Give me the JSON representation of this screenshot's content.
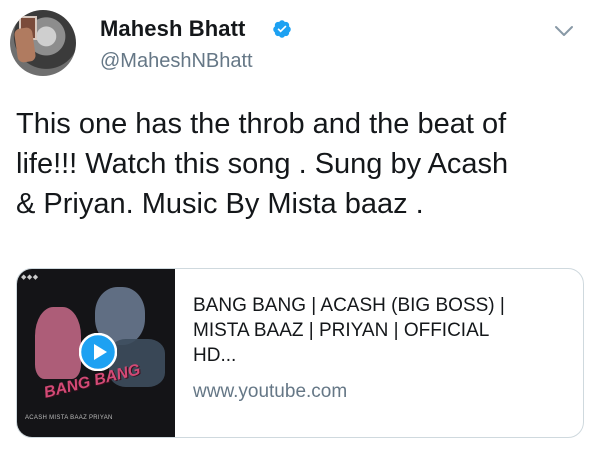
{
  "author": {
    "name": "Mahesh Bhatt",
    "handle": "@MaheshNBhatt",
    "verified": true,
    "verified_icon": "verified-badge-icon",
    "avatar_icon": "avatar-photo"
  },
  "menu_icon": "chevron-down-icon",
  "tweet": {
    "lines": [
      "This one has the throb and the beat of",
      "life!!! Watch this song .  Sung by Acash",
      "& Priyan. Music By Mista baaz ."
    ]
  },
  "link_card": {
    "title_lines": [
      "BANG BANG | ACASH (BIG BOSS) |",
      "MISTA BAAZ | PRIYAN | OFFICIAL",
      "HD..."
    ],
    "domain": "www.youtube.com",
    "thumbnail": {
      "title_art": "BANG BANG",
      "credits": "ACASH   MISTA BAAZ   PRIYAN",
      "play_icon": "play-icon"
    }
  },
  "colors": {
    "verified_blue": "#1da1f2",
    "text": "#14171a",
    "secondary_text": "#657786",
    "card_border": "#cfd9de"
  }
}
